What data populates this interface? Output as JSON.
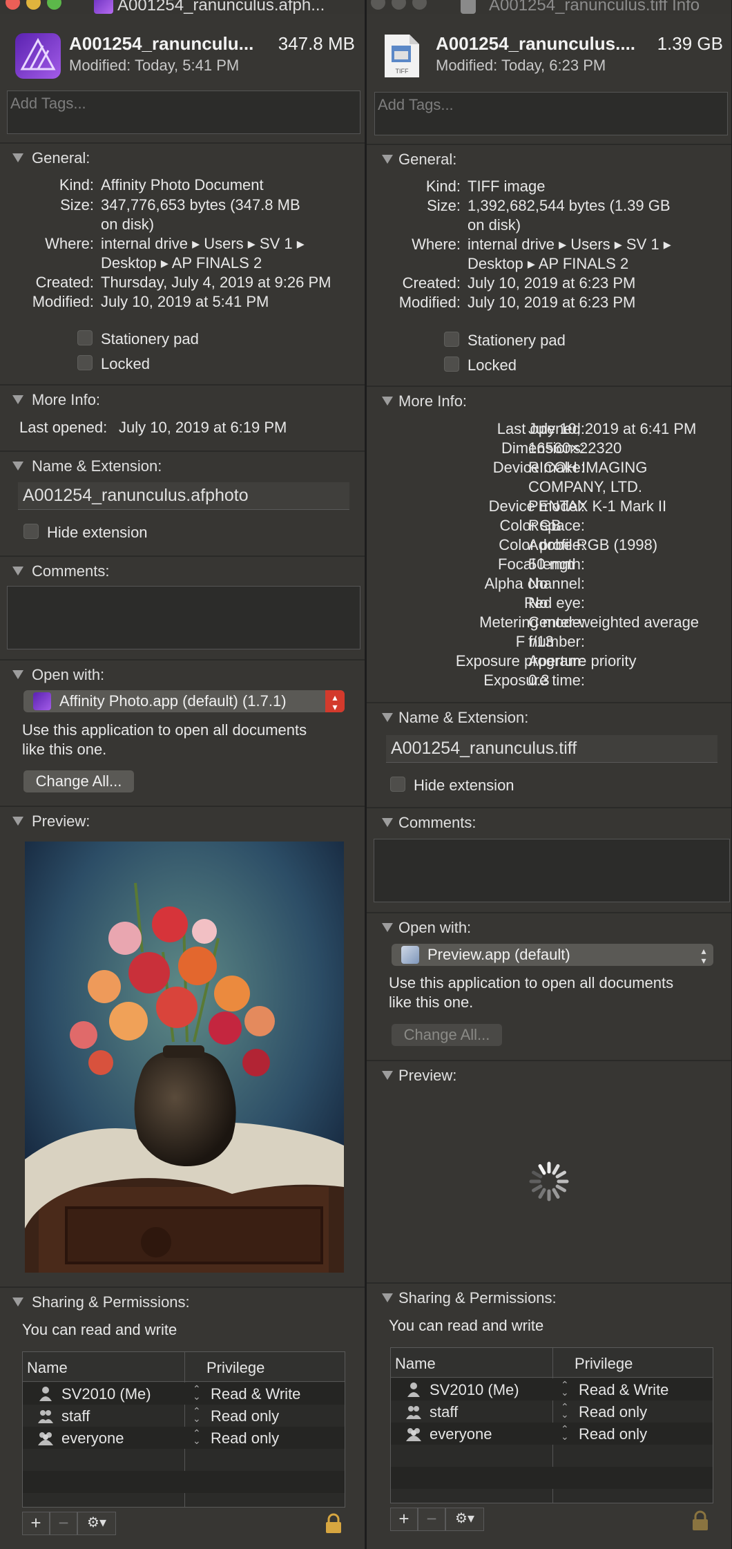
{
  "windows": [
    {
      "title": "A001254_ranunculus.afph...",
      "header": {
        "name": "A001254_ranunculu...",
        "size": "347.8 MB",
        "modified": "Modified:  Today, 5:41 PM"
      },
      "tags_placeholder": "Add Tags...",
      "general": {
        "heading": "General:",
        "kind_label": "Kind:",
        "kind": "Affinity Photo Document",
        "size_label": "Size:",
        "size_1": "347,776,653 bytes (347.8 MB",
        "size_2": "on disk)",
        "where_label": "Where:",
        "where_1": "internal drive ▸ Users ▸ SV 1 ▸",
        "where_2": "Desktop ▸ AP FINALS  2",
        "created_label": "Created:",
        "created": "Thursday, July 4, 2019 at 9:26 PM",
        "modified_label": "Modified:",
        "modified": "July 10, 2019 at 5:41 PM",
        "stationery": "Stationery pad",
        "locked": "Locked"
      },
      "more_info": {
        "heading": "More Info:",
        "last_opened_label": "Last opened:",
        "last_opened": "July 10, 2019 at 6:19 PM"
      },
      "name_ext": {
        "heading": "Name & Extension:",
        "filename": "A001254_ranunculus.afphoto",
        "hide_ext": "Hide extension"
      },
      "comments": {
        "heading": "Comments:"
      },
      "open_with": {
        "heading": "Open with:",
        "app": "Affinity Photo.app (default) (1.7.1)",
        "desc_1": "Use this application to open all documents",
        "desc_2": "like this one.",
        "change_all": "Change All..."
      },
      "preview": {
        "heading": "Preview:"
      },
      "sharing": {
        "heading": "Sharing & Permissions:",
        "status": "You can read and write",
        "col_name": "Name",
        "col_priv": "Privilege",
        "rows": [
          {
            "name": "SV2010 (Me)",
            "priv": "Read & Write"
          },
          {
            "name": "staff",
            "priv": "Read only"
          },
          {
            "name": "everyone",
            "priv": "Read only"
          }
        ]
      }
    },
    {
      "title": "A001254_ranunculus.tiff Info",
      "header": {
        "name": "A001254_ranunculus....",
        "size": "1.39 GB",
        "modified": "Modified:  Today, 6:23 PM"
      },
      "tags_placeholder": "Add Tags...",
      "general": {
        "heading": "General:",
        "kind_label": "Kind:",
        "kind": "TIFF image",
        "size_label": "Size:",
        "size_1": "1,392,682,544 bytes (1.39 GB",
        "size_2": "on disk)",
        "where_label": "Where:",
        "where_1": "internal drive ▸ Users ▸ SV 1 ▸",
        "where_2": "Desktop ▸ AP FINALS  2",
        "created_label": "Created:",
        "created": "July 10, 2019 at 6:23 PM",
        "modified_label": "Modified:",
        "modified": "July 10, 2019 at 6:23 PM",
        "stationery": "Stationery pad",
        "locked": "Locked"
      },
      "more_info": {
        "heading": "More Info:",
        "rows": [
          {
            "label": "Last opened:",
            "value": "July 10, 2019 at 6:41 PM"
          },
          {
            "label": "Dimensions:",
            "value": "16560×22320"
          },
          {
            "label": "Device make:",
            "value": "RICOH IMAGING"
          },
          {
            "label": "",
            "value": "COMPANY, LTD."
          },
          {
            "label": "Device model:",
            "value": "PENTAX K-1 Mark II"
          },
          {
            "label": "Color space:",
            "value": "RGB"
          },
          {
            "label": "Color profile:",
            "value": "Adobe RGB (1998)"
          },
          {
            "label": "Focal length:",
            "value": "50 mm"
          },
          {
            "label": "Alpha channel:",
            "value": "No"
          },
          {
            "label": "Red eye:",
            "value": "No"
          },
          {
            "label": "Metering mode:",
            "value": "Center-weighted average"
          },
          {
            "label": "F number:",
            "value": "f/13"
          },
          {
            "label": "Exposure program:",
            "value": "Aperture priority"
          },
          {
            "label": "Exposure time:",
            "value": "0.3"
          }
        ]
      },
      "name_ext": {
        "heading": "Name & Extension:",
        "filename": "A001254_ranunculus.tiff",
        "hide_ext": "Hide extension"
      },
      "comments": {
        "heading": "Comments:"
      },
      "open_with": {
        "heading": "Open with:",
        "app": "Preview.app (default)",
        "desc_1": "Use this application to open all documents",
        "desc_2": "like this one.",
        "change_all": "Change All..."
      },
      "preview": {
        "heading": "Preview:"
      },
      "sharing": {
        "heading": "Sharing & Permissions:",
        "status": "You can read and write",
        "col_name": "Name",
        "col_priv": "Privilege",
        "rows": [
          {
            "name": "SV2010 (Me)",
            "priv": "Read & Write"
          },
          {
            "name": "staff",
            "priv": "Read only"
          },
          {
            "name": "everyone",
            "priv": "Read only"
          }
        ]
      }
    }
  ],
  "colors": {
    "window_bg": "#373633",
    "affinity_purple": "#8b3fd6",
    "stepper_red": "#d33a2c",
    "lock_gold": "#d7a640"
  }
}
